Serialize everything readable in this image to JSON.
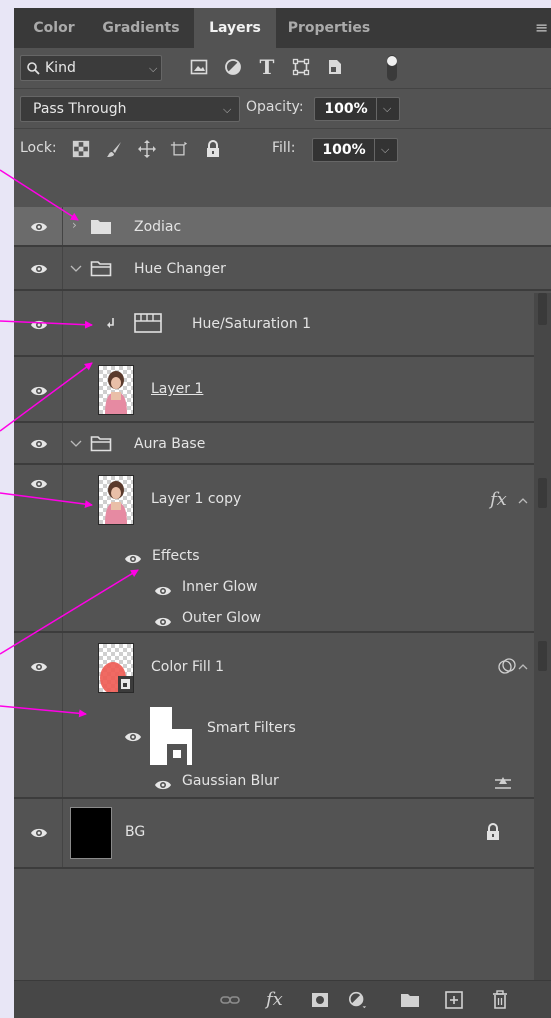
{
  "tabs": [
    {
      "label": "Color",
      "active": false
    },
    {
      "label": "Gradients",
      "active": false
    },
    {
      "label": "Layers",
      "active": true
    },
    {
      "label": "Properties",
      "active": false
    }
  ],
  "filter": {
    "kind_label": "Kind"
  },
  "blend": {
    "mode": "Pass Through",
    "opacity_label": "Opacity:",
    "opacity_value": "100%"
  },
  "lock": {
    "label": "Lock:",
    "fill_label": "Fill:",
    "fill_value": "100%"
  },
  "layers": {
    "zodiac": "Zodiac",
    "hue_changer": "Hue Changer",
    "hue_sat": "Hue/Saturation 1",
    "layer1": "Layer 1",
    "aura_base": "Aura Base",
    "layer1_copy": "Layer 1 copy",
    "fx_badge": "fx",
    "effects": "Effects",
    "inner_glow": "Inner Glow",
    "outer_glow": "Outer Glow",
    "color_fill": "Color Fill 1",
    "smart_filters": "Smart Filters",
    "gaussian_blur": "Gaussian Blur",
    "bg": "BG"
  },
  "colors": {
    "panel_bg": "#535353",
    "tab_bar": "#393939",
    "selected_row": "#6b6b6b",
    "annotation_arrow": "#ff00e6",
    "page_bg": "#e8e6f6"
  },
  "icons": {
    "bottom_bar": [
      "link-layers-icon",
      "add-style-icon",
      "add-mask-icon",
      "adjustment-icon",
      "new-group-icon",
      "new-layer-icon",
      "delete-icon"
    ]
  }
}
